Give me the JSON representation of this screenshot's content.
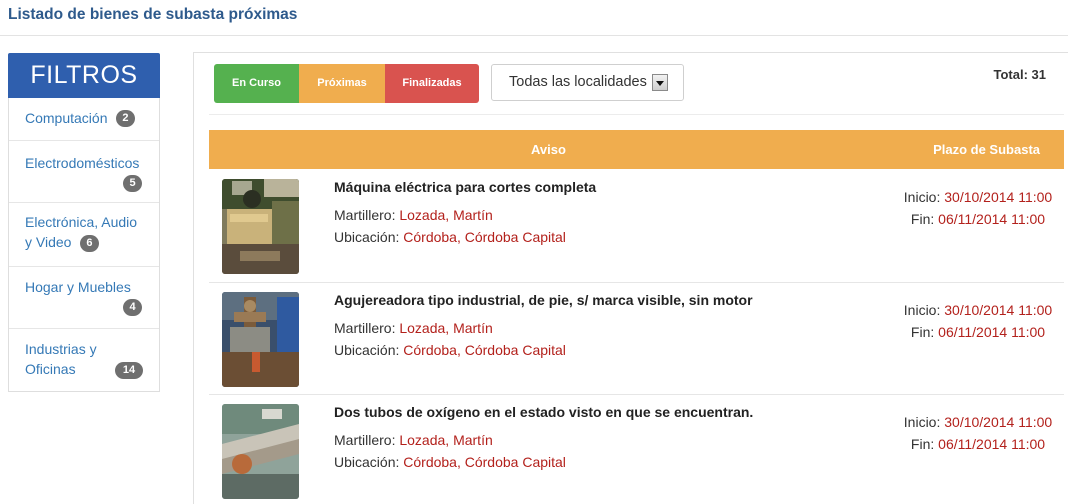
{
  "page": {
    "title": "Listado de bienes de subasta próximas"
  },
  "sidebar": {
    "header": "FILTROS",
    "categories": [
      {
        "label": "Computación",
        "count": "2"
      },
      {
        "label": "Electrodomésticos",
        "count": "5"
      },
      {
        "label": "Electrónica, Audio y Video",
        "count": "6"
      },
      {
        "label": "Hogar y Muebles",
        "count": "4"
      },
      {
        "label": "Industrias y Oficinas",
        "count": "14"
      }
    ]
  },
  "tabs": [
    {
      "label": "En Curso",
      "color": "#55b14f"
    },
    {
      "label": "Próximas",
      "color": "#f0ad4e"
    },
    {
      "label": "Finalizadas",
      "color": "#d9534f"
    }
  ],
  "location_select": {
    "selected": "Todas las localidades"
  },
  "total": "Total: 31",
  "table": {
    "headers": {
      "aviso": "Aviso",
      "plazo": "Plazo de Subasta"
    },
    "rows": [
      {
        "title": "Máquina eléctrica para cortes completa",
        "martillero_label": "Martillero: ",
        "martillero": "Lozada, Martín",
        "ubicacion_label": "Ubicación: ",
        "ubicacion": "Córdoba, Córdoba Capital",
        "inicio_label": "Inicio: ",
        "inicio": "30/10/2014 11:00",
        "fin_label": "Fin: ",
        "fin": "06/11/2014 11:00"
      },
      {
        "title": "Agujereadora tipo industrial, de pie, s/ marca visible, sin motor",
        "martillero_label": "Martillero: ",
        "martillero": "Lozada, Martín",
        "ubicacion_label": "Ubicación: ",
        "ubicacion": "Córdoba, Córdoba Capital",
        "inicio_label": "Inicio: ",
        "inicio": "30/10/2014 11:00",
        "fin_label": "Fin: ",
        "fin": "06/11/2014 11:00"
      },
      {
        "title": "Dos tubos de oxígeno en el estado visto en que se encuentran.",
        "martillero_label": "Martillero: ",
        "martillero": "Lozada, Martín",
        "ubicacion_label": "Ubicación: ",
        "ubicacion": "Córdoba, Córdoba Capital",
        "inicio_label": "Inicio: ",
        "inicio": "30/10/2014 11:00",
        "fin_label": "Fin: ",
        "fin": "06/11/2014 11:00"
      }
    ]
  },
  "colors": {
    "accent": "#f0ad4e",
    "brand": "#2f5fae",
    "link": "#3579b6",
    "value": "#b3211c"
  }
}
